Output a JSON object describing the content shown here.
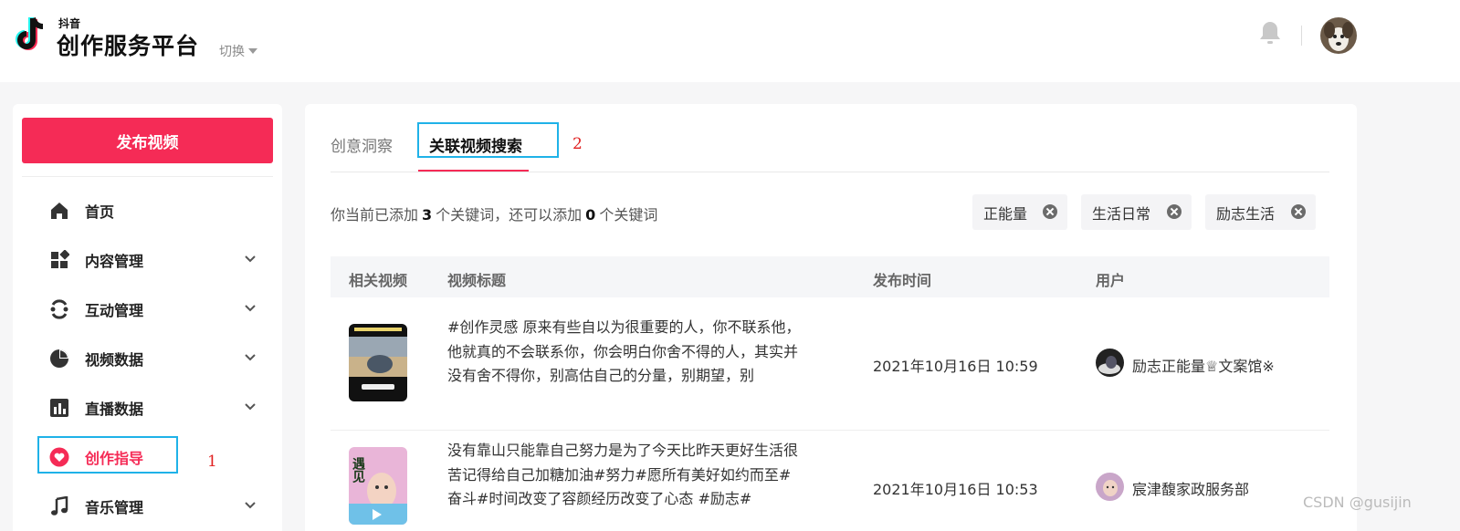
{
  "header": {
    "logo_small": "抖音",
    "logo_title": "创作服务平台",
    "switch_label": "切换"
  },
  "sidebar": {
    "publish_label": "发布视频",
    "items": [
      {
        "label": "首页",
        "icon": "home-icon",
        "expandable": false
      },
      {
        "label": "内容管理",
        "icon": "content-grid-icon",
        "expandable": true
      },
      {
        "label": "互动管理",
        "icon": "interaction-icon",
        "expandable": true
      },
      {
        "label": "视频数据",
        "icon": "pie-chart-icon",
        "expandable": true
      },
      {
        "label": "直播数据",
        "icon": "bar-chart-icon",
        "expandable": true
      },
      {
        "label": "创作指导",
        "icon": "heart-icon",
        "expandable": false,
        "active": true
      },
      {
        "label": "音乐管理",
        "icon": "music-note-icon",
        "expandable": true
      }
    ],
    "annotation": "1"
  },
  "main": {
    "tabs": [
      {
        "label": "创意洞察",
        "active": false
      },
      {
        "label": "关联视频搜索",
        "active": true
      }
    ],
    "tab_annotation": "2",
    "keywords_info": {
      "prefix": "你当前已添加",
      "added": "3",
      "middle": "个关键词，还可以添加",
      "remaining": "0",
      "suffix": "个关键词"
    },
    "tags": [
      "正能量",
      "生活日常",
      "励志生活"
    ],
    "table": {
      "headers": [
        "相关视频",
        "视频标题",
        "发布时间",
        "用户"
      ],
      "rows": [
        {
          "title": "#创作灵感 原来有些自以为很重要的人，你不联系他，他就真的不会联系你，你会明白你舍不得的人，其实并没有舍不得你，别高估自己的分量，别期望，别",
          "time": "2021年10月16日 10:59",
          "user": "励志正能量♕文案馆※"
        },
        {
          "title": "没有靠山只能靠自己努力是为了今天比昨天更好生活很苦记得给自己加糖加油#努力#愿所有美好如约而至#奋斗#时间改变了容颜经历改变了心态 #励志#",
          "time": "2021年10月16日 10:53",
          "user": "宸津馥家政服务部",
          "thumb_text": "遇见"
        }
      ]
    }
  },
  "watermark": "CSDN @gusijin",
  "colors": {
    "brand_red": "#f52b56",
    "annotation_blue": "#1fb2e8",
    "annotation_red": "#e02020"
  }
}
